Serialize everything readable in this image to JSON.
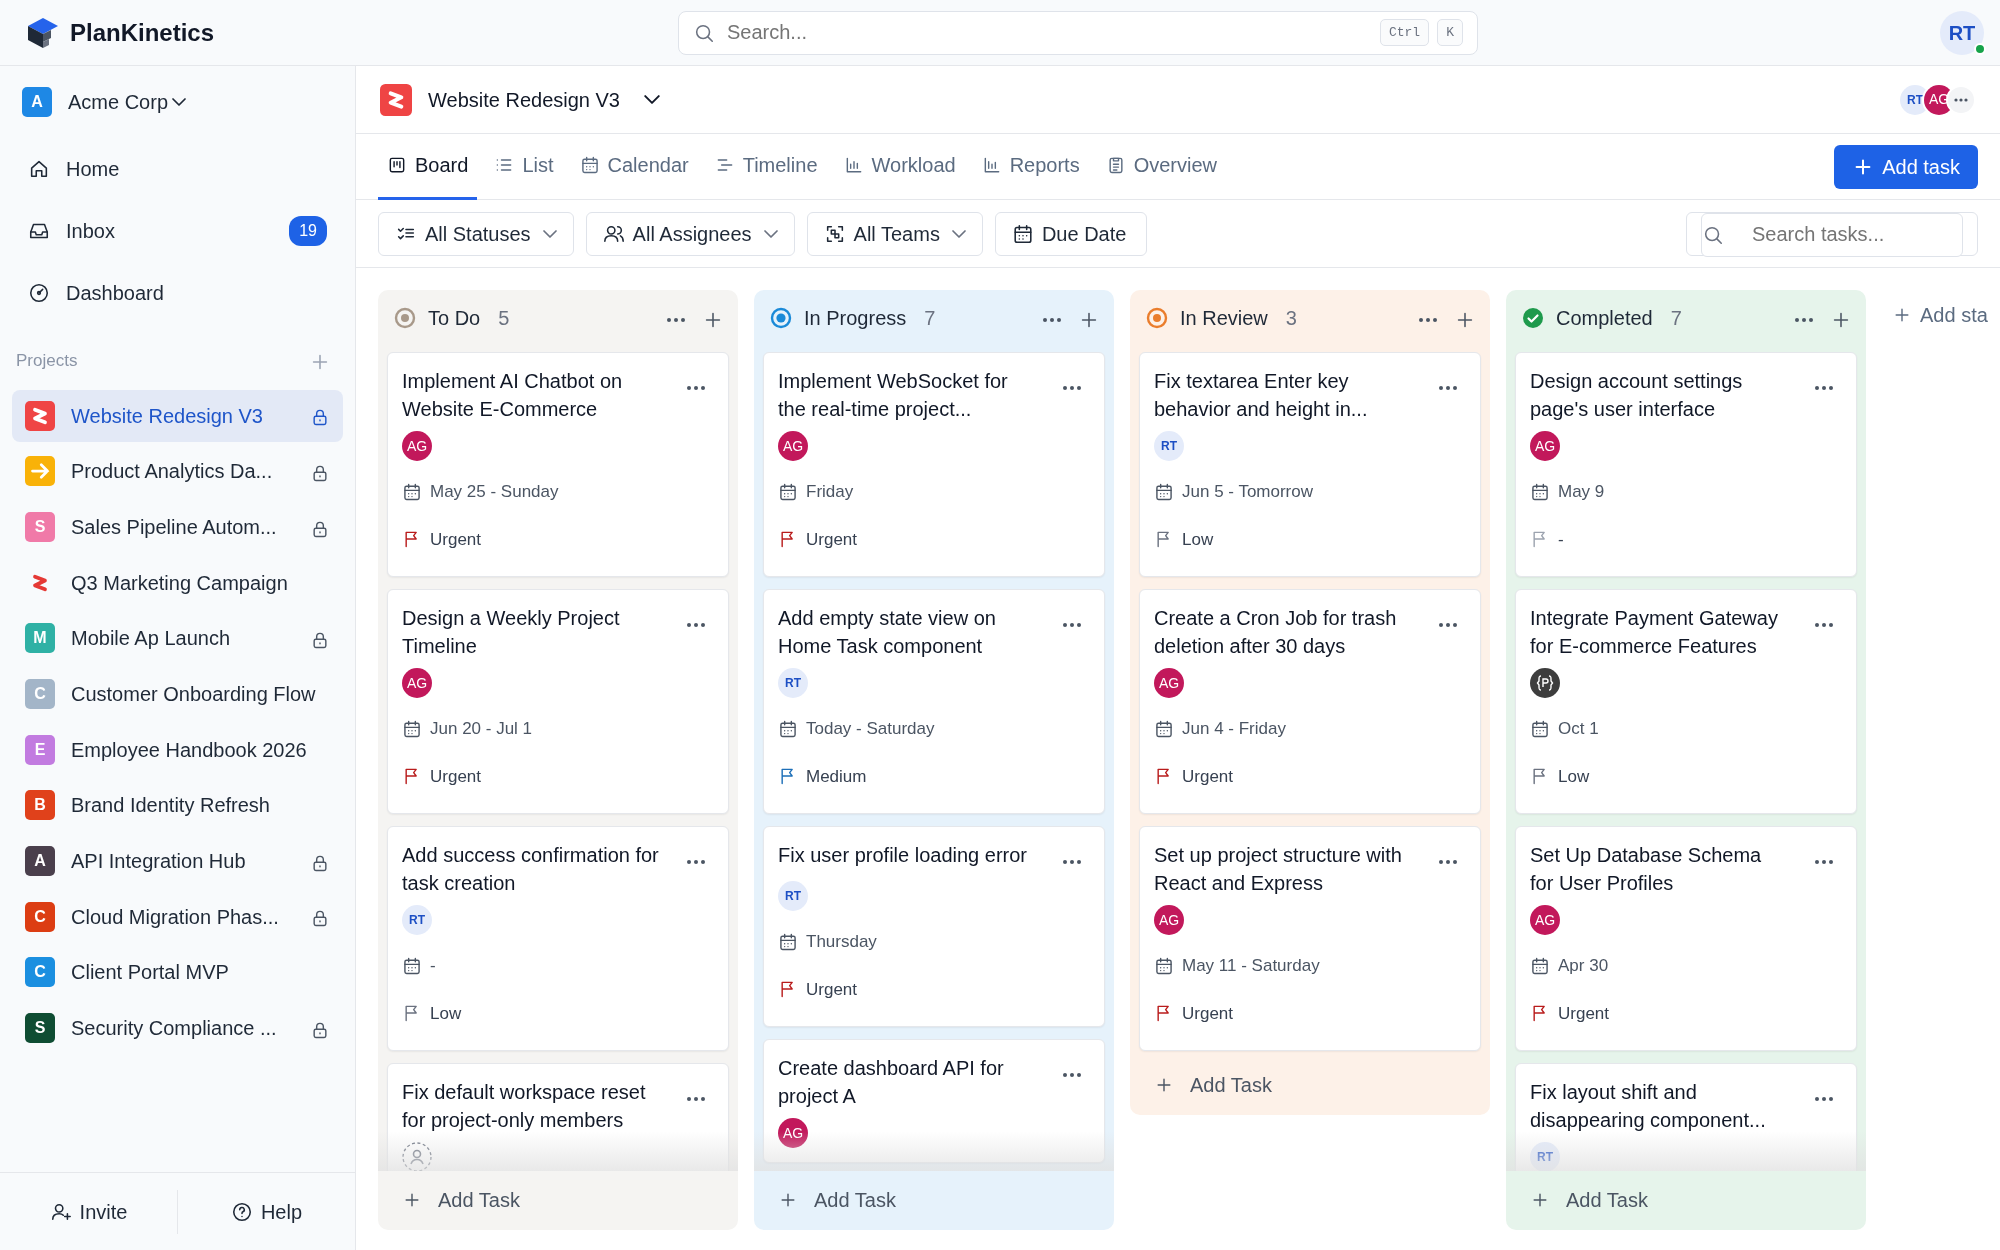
{
  "app": {
    "name": "PlanKinetics"
  },
  "search": {
    "placeholder": "Search...",
    "shortcut": [
      "Ctrl",
      "K"
    ]
  },
  "user": {
    "initials": "RT",
    "online": true
  },
  "sidebar": {
    "workspace": {
      "letter": "A",
      "name": "Acme Corp"
    },
    "nav": [
      {
        "label": "Home",
        "selected": false
      },
      {
        "label": "Inbox",
        "badge": "19",
        "selected": false
      },
      {
        "label": "Dashboard",
        "selected": false
      }
    ],
    "projects_label": "Projects",
    "projects": [
      {
        "name": "Website Redesign V3",
        "kind": "zigzag-tile",
        "color": "#ef4444",
        "locked": true,
        "selected": true
      },
      {
        "name": "Product Analytics Da...",
        "kind": "arrow-tile",
        "color": "#f9b208",
        "locked": true,
        "selected": false
      },
      {
        "name": "Sales Pipeline Autom...",
        "kind": "letter",
        "letter": "S",
        "color": "#f07aa8",
        "locked": true,
        "selected": false
      },
      {
        "name": "Q3 Marketing Campaign",
        "kind": "zigzag",
        "color": "#e53935",
        "locked": false,
        "selected": false
      },
      {
        "name": "Mobile Ap Launch",
        "kind": "letter",
        "letter": "M",
        "color": "#2fb1a5",
        "locked": true,
        "selected": false
      },
      {
        "name": "Customer Onboarding Flow",
        "kind": "letter",
        "letter": "C",
        "color": "#a3b5c8",
        "locked": false,
        "selected": false
      },
      {
        "name": "Employee Handbook 2026",
        "kind": "letter",
        "letter": "E",
        "color": "#c27be0",
        "locked": false,
        "selected": false
      },
      {
        "name": "Brand Identity Refresh",
        "kind": "letter",
        "letter": "B",
        "color": "#e0411b",
        "locked": false,
        "selected": false
      },
      {
        "name": "API Integration Hub",
        "kind": "letter",
        "letter": "A",
        "color": "#4a3f4c",
        "locked": true,
        "selected": false
      },
      {
        "name": "Cloud Migration Phas...",
        "kind": "letter",
        "letter": "C",
        "color": "#dc3d13",
        "locked": true,
        "selected": false
      },
      {
        "name": "Client Portal MVP",
        "kind": "letter",
        "letter": "C",
        "color": "#1b8fe0",
        "locked": false,
        "selected": false
      },
      {
        "name": "Security Compliance ...",
        "kind": "letter",
        "letter": "S",
        "color": "#0f4d33",
        "locked": true,
        "selected": false
      }
    ],
    "footer": [
      {
        "label": "Invite"
      },
      {
        "label": "Help"
      }
    ]
  },
  "project_header": {
    "name": "Website Redesign V3",
    "members": [
      {
        "kind": "soft",
        "initials": "RT"
      },
      {
        "kind": "filled",
        "initials": "AG"
      }
    ]
  },
  "tabs": [
    {
      "label": "Board",
      "selected": true
    },
    {
      "label": "List",
      "selected": false
    },
    {
      "label": "Calendar",
      "selected": false
    },
    {
      "label": "Timeline",
      "selected": false
    },
    {
      "label": "Workload",
      "selected": false
    },
    {
      "label": "Reports",
      "selected": false
    },
    {
      "label": "Overview",
      "selected": false
    }
  ],
  "add_task_button": "Add task",
  "filters": [
    {
      "label": "All Statuses",
      "dropdown": true
    },
    {
      "label": "All Assignees",
      "dropdown": true
    },
    {
      "label": "All Teams",
      "dropdown": true
    },
    {
      "label": "Due Date",
      "dropdown": false
    }
  ],
  "task_search": {
    "placeholder": "Search tasks..."
  },
  "columns": [
    {
      "title": "To Do",
      "count": "5",
      "kind": "todo",
      "color": "#a8998a",
      "add_label": "Add Task",
      "cards": [
        {
          "title": "Implement AI Chatbot on Website E-Commerce",
          "assignee": {
            "kind": "filled",
            "initials": "AG"
          },
          "date": "May 25 - Sunday",
          "priority": {
            "label": "Urgent",
            "kind": "urgent"
          }
        },
        {
          "title": "Design a Weekly Project Timeline",
          "assignee": {
            "kind": "filled",
            "initials": "AG"
          },
          "date": "Jun 20 - Jul 1",
          "priority": {
            "label": "Urgent",
            "kind": "urgent"
          }
        },
        {
          "title": "Add success confirmation for task creation",
          "assignee": {
            "kind": "soft",
            "initials": "RT"
          },
          "date": "-",
          "priority": {
            "label": "Low",
            "kind": "low"
          }
        },
        {
          "title": "Fix default workspace reset for project-only members",
          "assignee": {
            "kind": "unassigned"
          }
        }
      ]
    },
    {
      "title": "In Progress",
      "count": "7",
      "kind": "progress",
      "color": "#1a8ad8",
      "add_label": "Add Task",
      "cards": [
        {
          "title": "Implement WebSocket for the real-time project...",
          "assignee": {
            "kind": "filled",
            "initials": "AG"
          },
          "date": "Friday",
          "priority": {
            "label": "Urgent",
            "kind": "urgent"
          }
        },
        {
          "title": "Add empty state view on Home Task component",
          "assignee": {
            "kind": "soft",
            "initials": "RT"
          },
          "date": "Today - Saturday",
          "priority": {
            "label": "Medium",
            "kind": "medium"
          }
        },
        {
          "title": "Fix user profile loading error",
          "assignee": {
            "kind": "soft",
            "initials": "RT"
          },
          "date": "Thursday",
          "priority": {
            "label": "Urgent",
            "kind": "urgent"
          }
        },
        {
          "title": "Create dashboard API for project A",
          "assignee": {
            "kind": "filled",
            "initials": "AG"
          }
        }
      ]
    },
    {
      "title": "In Review",
      "count": "3",
      "kind": "review",
      "color": "#ea7d2c",
      "add_label": "Add Task",
      "cards": [
        {
          "title": "Fix textarea Enter key behavior and height in...",
          "assignee": {
            "kind": "soft",
            "initials": "RT"
          },
          "date": "Jun 5 - Tomorrow",
          "priority": {
            "label": "Low",
            "kind": "low"
          }
        },
        {
          "title": "Create a Cron Job for trash deletion after 30 days",
          "assignee": {
            "kind": "filled",
            "initials": "AG"
          },
          "date": "Jun 4 - Friday",
          "priority": {
            "label": "Urgent",
            "kind": "urgent"
          }
        },
        {
          "title": "Set up project structure with React and Express",
          "assignee": {
            "kind": "filled",
            "initials": "AG"
          },
          "date": "May 11 - Saturday",
          "priority": {
            "label": "Urgent",
            "kind": "urgent"
          }
        }
      ]
    },
    {
      "title": "Completed",
      "count": "7",
      "kind": "done",
      "color": "#1e9a4c",
      "add_label": "Add Task",
      "cards": [
        {
          "title": "Design account settings page's user interface",
          "assignee": {
            "kind": "filled",
            "initials": "AG"
          },
          "date": "May 9",
          "priority": {
            "label": "-",
            "kind": "none"
          }
        },
        {
          "title": "Integrate Payment Gateway for E-commerce Features",
          "assignee": {
            "kind": "logo"
          },
          "date": "Oct 1",
          "priority": {
            "label": "Low",
            "kind": "low"
          }
        },
        {
          "title": "Set Up Database Schema for User Profiles",
          "assignee": {
            "kind": "filled",
            "initials": "AG"
          },
          "date": "Apr 30",
          "priority": {
            "label": "Urgent",
            "kind": "urgent"
          }
        },
        {
          "title": "Fix layout shift and disappearing component...",
          "assignee": {
            "kind": "soft",
            "initials": "RT"
          }
        }
      ]
    }
  ],
  "add_status": "Add sta"
}
